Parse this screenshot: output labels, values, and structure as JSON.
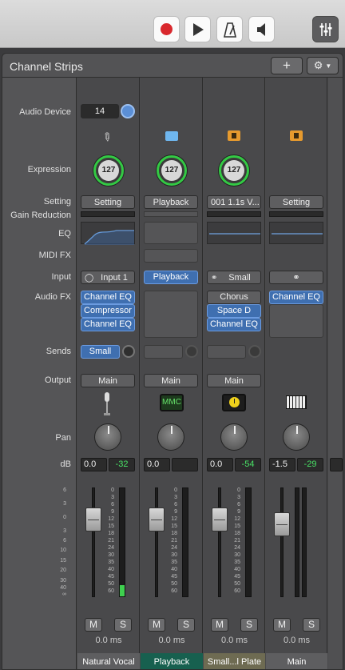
{
  "toolbar": {
    "record": "record-button",
    "play": "play-button",
    "metronome": "metronome-button",
    "speaker": "speaker-button",
    "mixer": "mixer-button"
  },
  "panel": {
    "title": "Channel Strips",
    "add_label": "+",
    "gear_label": "⚙"
  },
  "labels": {
    "audio_device": "Audio Device",
    "expression": "Expression",
    "setting": "Setting",
    "gain_reduction": "Gain Reduction",
    "eq": "EQ",
    "midi_fx": "MIDI FX",
    "input": "Input",
    "audio_fx": "Audio FX",
    "sends": "Sends",
    "output": "Output",
    "pan": "Pan",
    "db": "dB"
  },
  "left_scale": [
    "6",
    "3",
    "0",
    "3",
    "6",
    "10",
    "15",
    "20",
    "30",
    "40",
    "∞"
  ],
  "strip_scale": [
    "0",
    "3",
    "6",
    "9",
    "12",
    "15",
    "18",
    "21",
    "24",
    "30",
    "35",
    "40",
    "45",
    "50",
    "60"
  ],
  "colors": {
    "accent_blue": "#3f6fb0",
    "meter_green": "#49e266",
    "knob_green": "#33c944",
    "record_red": "#d9282d"
  },
  "strips": [
    {
      "name": "Natural Vocal",
      "name_bg": "#5e5e60",
      "audio_device": "14",
      "icon": "microphone-icon",
      "expression": "127",
      "setting": "Setting",
      "input": "Input 1",
      "audio_fx": [
        "Channel EQ",
        "Compressor",
        "Channel EQ"
      ],
      "send": "Small",
      "output": "Main",
      "output_icon": "microphone-icon",
      "db": "0.0",
      "peak": "-32",
      "ms_time": "0.0 ms",
      "mute": "M",
      "solo": "S"
    },
    {
      "name": "Playback",
      "name_bg": "#17604f",
      "icon": "folder-icon",
      "expression": "127",
      "setting": "Playback",
      "input": "Playback",
      "audio_fx": [],
      "output": "Main",
      "output_icon": "mmc-icon",
      "output_label": "MMC",
      "db": "0.0",
      "peak": "",
      "ms_time": "0.0 ms",
      "mute": "M",
      "solo": "S"
    },
    {
      "name": "Small...l Plate",
      "name_bg": "#6e6b52",
      "icon": "aux-folder-icon",
      "expression": "127",
      "setting": "001 1.1s V...",
      "input": "Small",
      "audio_fx": [
        "Chorus",
        "Space D",
        "Channel EQ"
      ],
      "output": "Main",
      "output_icon": "tuner-icon",
      "db": "0.0",
      "peak": "-54",
      "ms_time": "0.0 ms",
      "mute": "M",
      "solo": "S"
    },
    {
      "name": "Main",
      "name_bg": "#5e5e60",
      "icon": "aux-folder-icon",
      "setting": "Setting",
      "input": "",
      "audio_fx": [
        "Channel EQ"
      ],
      "output_icon": "keyboard-icon",
      "db": "-1.5",
      "peak": "-29",
      "ms_time": "0.0 ms",
      "mute": "M",
      "solo": "S"
    }
  ]
}
